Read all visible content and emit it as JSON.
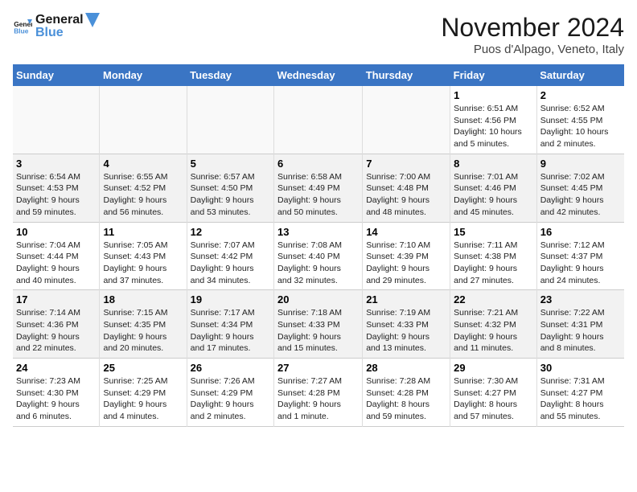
{
  "logo": {
    "line1": "General",
    "line2": "Blue"
  },
  "title": "November 2024",
  "location": "Puos d'Alpago, Veneto, Italy",
  "weekdays": [
    "Sunday",
    "Monday",
    "Tuesday",
    "Wednesday",
    "Thursday",
    "Friday",
    "Saturday"
  ],
  "weeks": [
    [
      {
        "day": "",
        "info": ""
      },
      {
        "day": "",
        "info": ""
      },
      {
        "day": "",
        "info": ""
      },
      {
        "day": "",
        "info": ""
      },
      {
        "day": "",
        "info": ""
      },
      {
        "day": "1",
        "info": "Sunrise: 6:51 AM\nSunset: 4:56 PM\nDaylight: 10 hours\nand 5 minutes."
      },
      {
        "day": "2",
        "info": "Sunrise: 6:52 AM\nSunset: 4:55 PM\nDaylight: 10 hours\nand 2 minutes."
      }
    ],
    [
      {
        "day": "3",
        "info": "Sunrise: 6:54 AM\nSunset: 4:53 PM\nDaylight: 9 hours\nand 59 minutes."
      },
      {
        "day": "4",
        "info": "Sunrise: 6:55 AM\nSunset: 4:52 PM\nDaylight: 9 hours\nand 56 minutes."
      },
      {
        "day": "5",
        "info": "Sunrise: 6:57 AM\nSunset: 4:50 PM\nDaylight: 9 hours\nand 53 minutes."
      },
      {
        "day": "6",
        "info": "Sunrise: 6:58 AM\nSunset: 4:49 PM\nDaylight: 9 hours\nand 50 minutes."
      },
      {
        "day": "7",
        "info": "Sunrise: 7:00 AM\nSunset: 4:48 PM\nDaylight: 9 hours\nand 48 minutes."
      },
      {
        "day": "8",
        "info": "Sunrise: 7:01 AM\nSunset: 4:46 PM\nDaylight: 9 hours\nand 45 minutes."
      },
      {
        "day": "9",
        "info": "Sunrise: 7:02 AM\nSunset: 4:45 PM\nDaylight: 9 hours\nand 42 minutes."
      }
    ],
    [
      {
        "day": "10",
        "info": "Sunrise: 7:04 AM\nSunset: 4:44 PM\nDaylight: 9 hours\nand 40 minutes."
      },
      {
        "day": "11",
        "info": "Sunrise: 7:05 AM\nSunset: 4:43 PM\nDaylight: 9 hours\nand 37 minutes."
      },
      {
        "day": "12",
        "info": "Sunrise: 7:07 AM\nSunset: 4:42 PM\nDaylight: 9 hours\nand 34 minutes."
      },
      {
        "day": "13",
        "info": "Sunrise: 7:08 AM\nSunset: 4:40 PM\nDaylight: 9 hours\nand 32 minutes."
      },
      {
        "day": "14",
        "info": "Sunrise: 7:10 AM\nSunset: 4:39 PM\nDaylight: 9 hours\nand 29 minutes."
      },
      {
        "day": "15",
        "info": "Sunrise: 7:11 AM\nSunset: 4:38 PM\nDaylight: 9 hours\nand 27 minutes."
      },
      {
        "day": "16",
        "info": "Sunrise: 7:12 AM\nSunset: 4:37 PM\nDaylight: 9 hours\nand 24 minutes."
      }
    ],
    [
      {
        "day": "17",
        "info": "Sunrise: 7:14 AM\nSunset: 4:36 PM\nDaylight: 9 hours\nand 22 minutes."
      },
      {
        "day": "18",
        "info": "Sunrise: 7:15 AM\nSunset: 4:35 PM\nDaylight: 9 hours\nand 20 minutes."
      },
      {
        "day": "19",
        "info": "Sunrise: 7:17 AM\nSunset: 4:34 PM\nDaylight: 9 hours\nand 17 minutes."
      },
      {
        "day": "20",
        "info": "Sunrise: 7:18 AM\nSunset: 4:33 PM\nDaylight: 9 hours\nand 15 minutes."
      },
      {
        "day": "21",
        "info": "Sunrise: 7:19 AM\nSunset: 4:33 PM\nDaylight: 9 hours\nand 13 minutes."
      },
      {
        "day": "22",
        "info": "Sunrise: 7:21 AM\nSunset: 4:32 PM\nDaylight: 9 hours\nand 11 minutes."
      },
      {
        "day": "23",
        "info": "Sunrise: 7:22 AM\nSunset: 4:31 PM\nDaylight: 9 hours\nand 8 minutes."
      }
    ],
    [
      {
        "day": "24",
        "info": "Sunrise: 7:23 AM\nSunset: 4:30 PM\nDaylight: 9 hours\nand 6 minutes."
      },
      {
        "day": "25",
        "info": "Sunrise: 7:25 AM\nSunset: 4:29 PM\nDaylight: 9 hours\nand 4 minutes."
      },
      {
        "day": "26",
        "info": "Sunrise: 7:26 AM\nSunset: 4:29 PM\nDaylight: 9 hours\nand 2 minutes."
      },
      {
        "day": "27",
        "info": "Sunrise: 7:27 AM\nSunset: 4:28 PM\nDaylight: 9 hours\nand 1 minute."
      },
      {
        "day": "28",
        "info": "Sunrise: 7:28 AM\nSunset: 4:28 PM\nDaylight: 8 hours\nand 59 minutes."
      },
      {
        "day": "29",
        "info": "Sunrise: 7:30 AM\nSunset: 4:27 PM\nDaylight: 8 hours\nand 57 minutes."
      },
      {
        "day": "30",
        "info": "Sunrise: 7:31 AM\nSunset: 4:27 PM\nDaylight: 8 hours\nand 55 minutes."
      }
    ]
  ]
}
